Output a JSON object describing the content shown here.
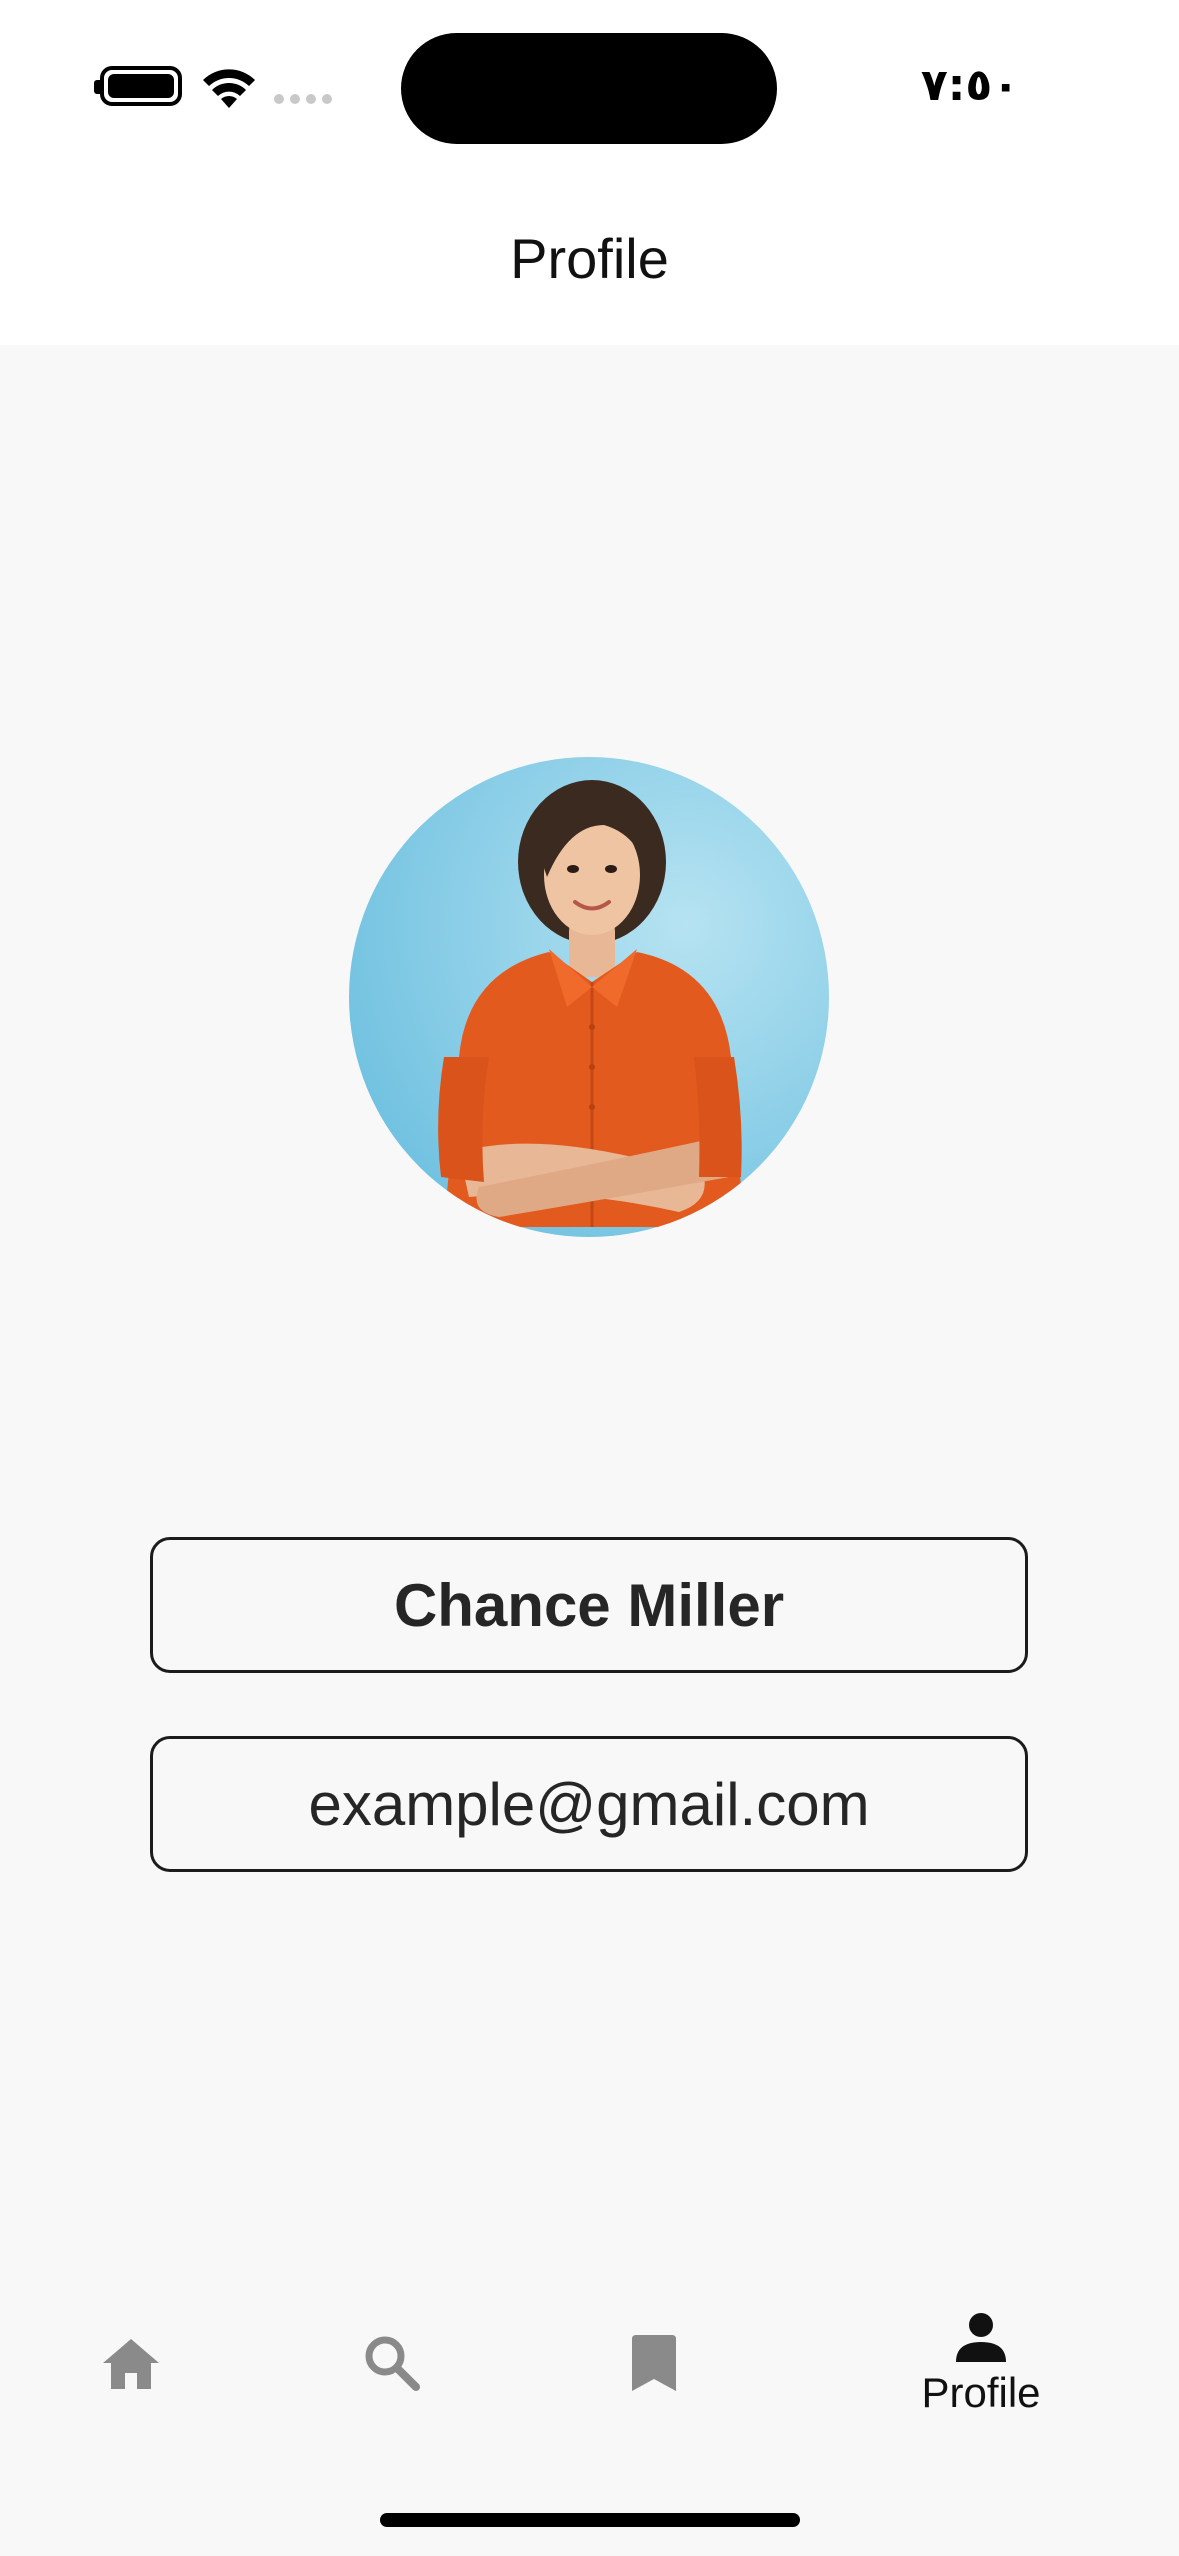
{
  "status_bar": {
    "time": "٧:٥٠",
    "icons": [
      "battery-icon",
      "wifi-icon",
      "signal-icon"
    ]
  },
  "header": {
    "title": "Profile"
  },
  "profile": {
    "avatar_icon": "person-photo",
    "name": "Chance Miller",
    "email": "example@gmail.com"
  },
  "tab_bar": {
    "active_tab": "profile",
    "tabs": [
      {
        "id": "home",
        "icon": "home-icon",
        "label": ""
      },
      {
        "id": "search",
        "icon": "search-icon",
        "label": ""
      },
      {
        "id": "bookmarks",
        "icon": "bookmark-icon",
        "label": ""
      },
      {
        "id": "profile",
        "icon": "person-icon",
        "label": "Profile"
      }
    ]
  },
  "colors": {
    "background": "#f8f8f8",
    "header_background": "#ffffff",
    "active_icon": "#111111",
    "inactive_icon": "#8a8a8a",
    "field_border": "#1c1c1c"
  }
}
